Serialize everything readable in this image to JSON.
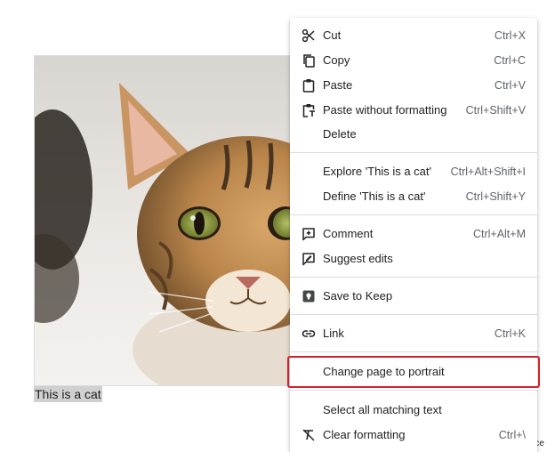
{
  "document": {
    "caption": "This is a cat",
    "watermark": "guiaworkspace"
  },
  "context_menu": {
    "items": [
      {
        "label": "Cut",
        "shortcut": "Ctrl+X",
        "icon": "scissors-icon"
      },
      {
        "label": "Copy",
        "shortcut": "Ctrl+C",
        "icon": "copy-icon"
      },
      {
        "label": "Paste",
        "shortcut": "Ctrl+V",
        "icon": "clipboard-icon"
      },
      {
        "label": "Paste without formatting",
        "shortcut": "Ctrl+Shift+V",
        "icon": "paste-plain-icon"
      },
      {
        "label": "Delete",
        "shortcut": "",
        "icon": ""
      },
      {
        "label": "Explore 'This is a cat'",
        "shortcut": "Ctrl+Alt+Shift+I",
        "icon": ""
      },
      {
        "label": "Define 'This is a cat'",
        "shortcut": "Ctrl+Shift+Y",
        "icon": ""
      },
      {
        "label": "Comment",
        "shortcut": "Ctrl+Alt+M",
        "icon": "add-comment-icon"
      },
      {
        "label": "Suggest edits",
        "shortcut": "",
        "icon": "suggest-edits-icon"
      },
      {
        "label": "Save to Keep",
        "shortcut": "",
        "icon": "keep-icon"
      },
      {
        "label": "Link",
        "shortcut": "Ctrl+K",
        "icon": "link-icon"
      },
      {
        "label": "Change page to portrait",
        "shortcut": "",
        "icon": ""
      },
      {
        "label": "Select all matching text",
        "shortcut": "",
        "icon": ""
      },
      {
        "label": "Clear formatting",
        "shortcut": "Ctrl+\\",
        "icon": "clear-formatting-icon"
      }
    ],
    "highlight_color": "#d61f2c"
  }
}
